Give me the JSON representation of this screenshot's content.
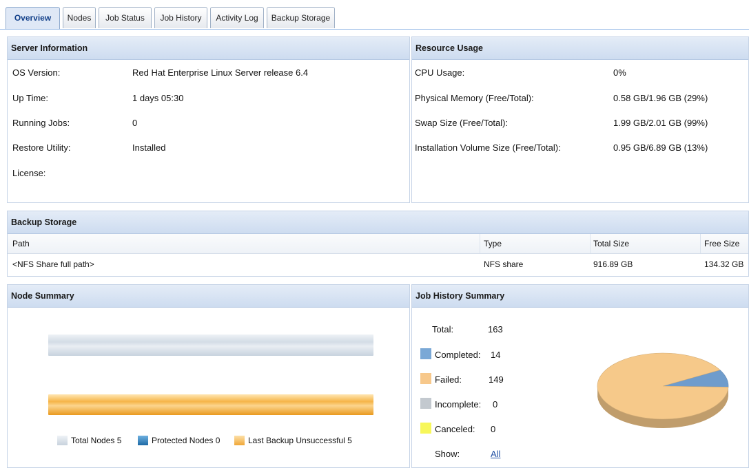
{
  "tabs": [
    {
      "label": "Overview",
      "active": true
    },
    {
      "label": "Nodes",
      "active": false
    },
    {
      "label": "Job Status",
      "active": false
    },
    {
      "label": "Job History",
      "active": false
    },
    {
      "label": "Activity Log",
      "active": false
    },
    {
      "label": "Backup Storage",
      "active": false
    }
  ],
  "server_info": {
    "title": "Server Information",
    "rows": [
      {
        "label": "OS Version:",
        "value": "Red Hat Enterprise Linux Server release 6.4"
      },
      {
        "label": "Up Time:",
        "value": "1 days 05:30"
      },
      {
        "label": "Running Jobs:",
        "value": "0"
      },
      {
        "label": "Restore Utility:",
        "value": "Installed"
      },
      {
        "label": "License:",
        "value": ""
      }
    ]
  },
  "resource_usage": {
    "title": "Resource Usage",
    "rows": [
      {
        "label": "CPU Usage:",
        "value": "0%"
      },
      {
        "label": "Physical Memory (Free/Total):",
        "value": "0.58 GB/1.96 GB (29%)"
      },
      {
        "label": "Swap Size (Free/Total):",
        "value": "1.99 GB/2.01 GB (99%)"
      },
      {
        "label": "Installation Volume Size (Free/Total):",
        "value": "0.95 GB/6.89 GB (13%)"
      }
    ]
  },
  "backup_storage": {
    "title": "Backup Storage",
    "columns": [
      "Path",
      "Type",
      "Total Size",
      "Free Size"
    ],
    "rows": [
      {
        "path": "<NFS Share full path>",
        "type": "NFS share",
        "total": "916.89 GB",
        "free": "134.32 GB"
      }
    ]
  },
  "node_summary": {
    "title": "Node Summary",
    "legend": [
      {
        "label": "Total Nodes 5",
        "value": 5,
        "color": "#d4dde8"
      },
      {
        "label": "Protected Nodes 0",
        "value": 0,
        "color": "#3b86c0"
      },
      {
        "label": "Last Backup Unsuccessful 5",
        "value": 5,
        "color": "#f5b44a"
      }
    ]
  },
  "job_history": {
    "title": "Job History Summary",
    "total_label": "Total:",
    "total_value": "163",
    "items": [
      {
        "label": "Completed:",
        "value": "14",
        "color": "#7aa8d6"
      },
      {
        "label": "Failed:",
        "value": "149",
        "color": "#f7c88b"
      },
      {
        "label": "Incomplete:",
        "value": "0",
        "color": "#c3c9cf"
      },
      {
        "label": "Canceled:",
        "value": "0",
        "color": "#f7f75a"
      }
    ],
    "show_label": "Show:",
    "show_link": "All",
    "pie": [
      {
        "name": "Completed",
        "value": 14,
        "color": "#6f9ccc"
      },
      {
        "name": "Failed",
        "value": 149,
        "color": "#f6c98a"
      }
    ]
  }
}
